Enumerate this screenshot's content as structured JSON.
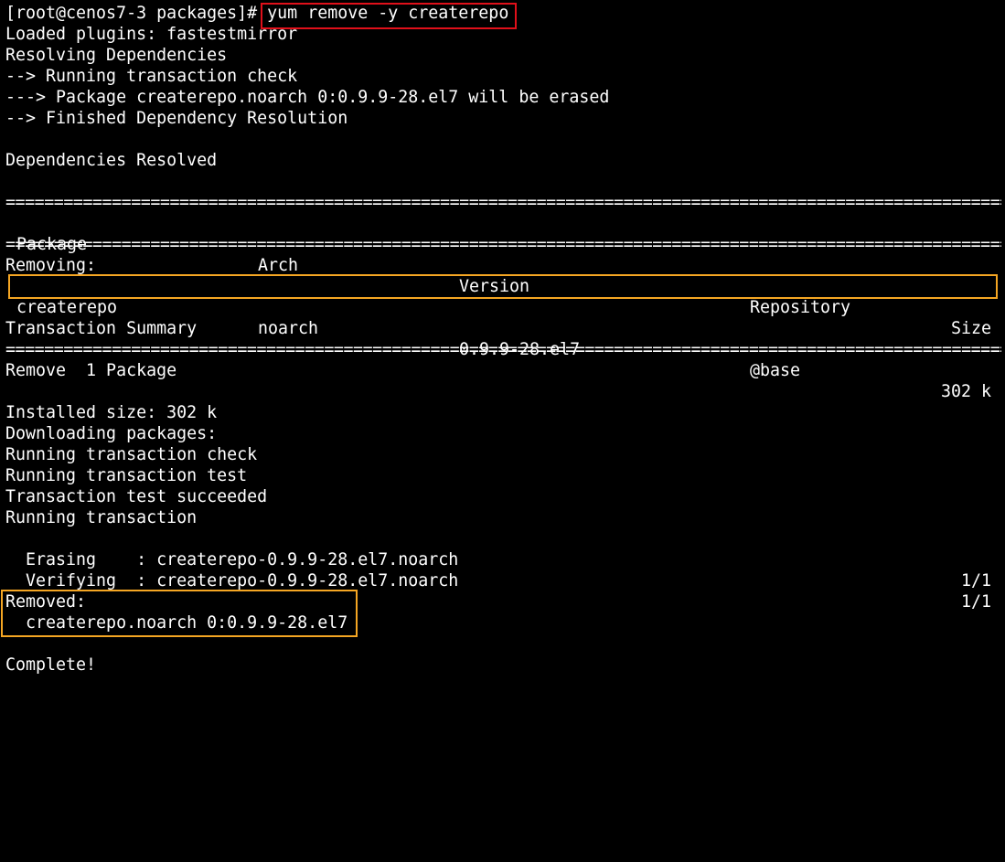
{
  "terminal": {
    "prompt": "[root@cenos7-3 packages]# ",
    "command": "yum remove -y createrepo",
    "lines_top": [
      "Loaded plugins: fastestmirror",
      "Resolving Dependencies",
      "--> Running transaction check",
      "---> Package createrepo.noarch 0:0.9.9-28.el7 will be erased",
      "--> Finished Dependency Resolution",
      "Dependencies Resolved"
    ],
    "separator": "================================================================================================================",
    "table_header": {
      "package": "Package",
      "arch": "Arch",
      "version": "Version",
      "repository": "Repository",
      "size": "Size"
    },
    "removing_label": "Removing:",
    "table_row": {
      "package": "createrepo",
      "arch": "noarch",
      "version": "0.9.9-28.el7",
      "repository": "@base",
      "size": "302 k"
    },
    "transaction_summary": "Transaction Summary",
    "remove_count": "Remove  1 Package",
    "installed_size": "Installed size: 302 k",
    "lines_bottom": [
      "Downloading packages:",
      "Running transaction check",
      "Running transaction test",
      "Transaction test succeeded",
      "Running transaction"
    ],
    "erasing": {
      "label": "  Erasing    : createrepo-0.9.9-28.el7.noarch",
      "progress": "1/1"
    },
    "verifying": {
      "label": "  Verifying  : createrepo-0.9.9-28.el7.noarch",
      "progress": "1/1"
    },
    "removed_label": "Removed:",
    "removed_package": "  createrepo.noarch 0:0.9.9-28.el7",
    "complete": "Complete!"
  },
  "colors": {
    "background": "#000000",
    "text": "#ffffff",
    "highlight_command": "#e0101a",
    "highlight_result": "#f5a623"
  }
}
